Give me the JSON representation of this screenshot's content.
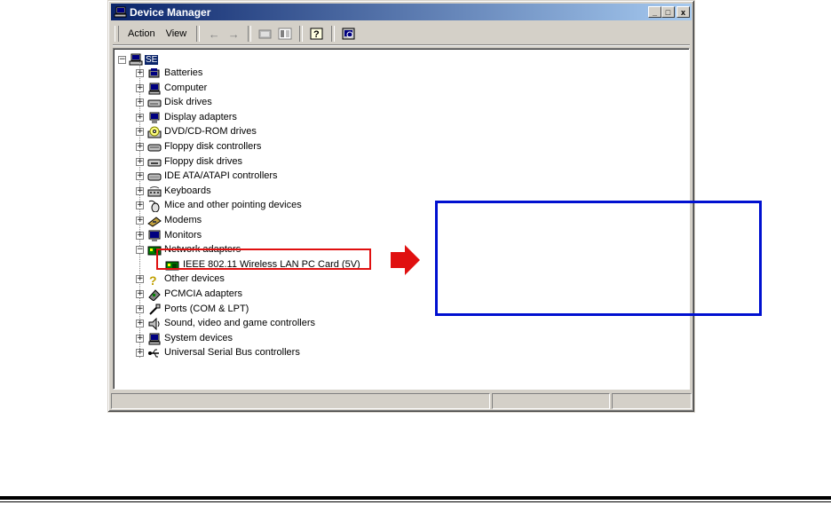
{
  "window": {
    "title": "Device Manager",
    "minimize": "_",
    "maximize": "□",
    "close": "x"
  },
  "menu": {
    "action": "Action",
    "view": "View"
  },
  "tree": {
    "root_label": "SE",
    "items": [
      {
        "label": "Batteries",
        "icon": "battery-icon",
        "expander": "+"
      },
      {
        "label": "Computer",
        "icon": "computer-icon",
        "expander": "+"
      },
      {
        "label": "Disk drives",
        "icon": "disk-drive-icon",
        "expander": "+"
      },
      {
        "label": "Display adapters",
        "icon": "display-adapter-icon",
        "expander": "+"
      },
      {
        "label": "DVD/CD-ROM drives",
        "icon": "dvd-drive-icon",
        "expander": "+"
      },
      {
        "label": "Floppy disk controllers",
        "icon": "controller-icon",
        "expander": "+"
      },
      {
        "label": "Floppy disk drives",
        "icon": "floppy-drive-icon",
        "expander": "+"
      },
      {
        "label": "IDE ATA/ATAPI controllers",
        "icon": "ide-controller-icon",
        "expander": "+"
      },
      {
        "label": "Keyboards",
        "icon": "keyboard-icon",
        "expander": "+"
      },
      {
        "label": "Mice and other pointing devices",
        "icon": "mouse-icon",
        "expander": "+"
      },
      {
        "label": "Modems",
        "icon": "modem-icon",
        "expander": "+"
      },
      {
        "label": "Monitors",
        "icon": "monitor-icon",
        "expander": "+"
      },
      {
        "label": "Network adapters",
        "icon": "network-adapter-icon",
        "expander": "-"
      },
      {
        "label": "IEEE 802.11 Wireless LAN PC Card (5V)",
        "icon": "network-card-icon",
        "expander": "",
        "child": true
      },
      {
        "label": "Other devices",
        "icon": "unknown-device-icon",
        "expander": "+"
      },
      {
        "label": "PCMCIA adapters",
        "icon": "pcmcia-icon",
        "expander": "+"
      },
      {
        "label": "Ports (COM & LPT)",
        "icon": "port-icon",
        "expander": "+"
      },
      {
        "label": "Sound, video and game controllers",
        "icon": "sound-icon",
        "expander": "+"
      },
      {
        "label": "System devices",
        "icon": "system-device-icon",
        "expander": "+"
      },
      {
        "label": "Universal Serial Bus controllers",
        "icon": "usb-icon",
        "expander": "+"
      }
    ]
  },
  "colors": {
    "titlebar_start": "#0a246a",
    "highlight_red": "#e01010",
    "arrow_red": "#e01010",
    "callout_blue": "#0010d0"
  }
}
